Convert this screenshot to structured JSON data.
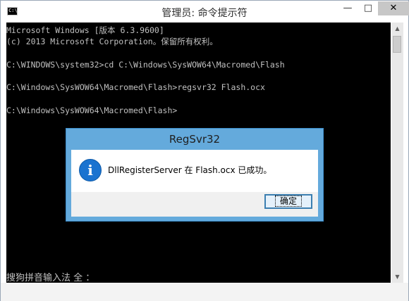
{
  "window": {
    "title": "管理员: 命令提示符",
    "icon_text": "C:\\",
    "controls": {
      "minimize": "—",
      "maximize": "□",
      "close": "✕"
    }
  },
  "console": {
    "lines": [
      "Microsoft Windows [版本 6.3.9600]",
      "(c) 2013 Microsoft Corporation。保留所有权利。",
      "",
      "C:\\WINDOWS\\system32>cd C:\\Windows\\SysWOW64\\Macromed\\Flash",
      "",
      "C:\\Windows\\SysWOW64\\Macromed\\Flash>regsvr32 Flash.ocx",
      "",
      "C:\\Windows\\SysWOW64\\Macromed\\Flash>"
    ],
    "ime_status": "搜狗拼音输入法 全 ："
  },
  "scrollbar": {
    "up_arrow": "▲",
    "down_arrow": "▼"
  },
  "dialog": {
    "title": "RegSvr32",
    "icon_glyph": "i",
    "message": "DllRegisterServer 在 Flash.ocx 已成功。",
    "ok_label": "确定"
  },
  "colors": {
    "console_bg": "#000000",
    "console_text": "#c0c0c0",
    "dialog_frame": "#64aadc",
    "info_icon": "#1a73d0"
  }
}
